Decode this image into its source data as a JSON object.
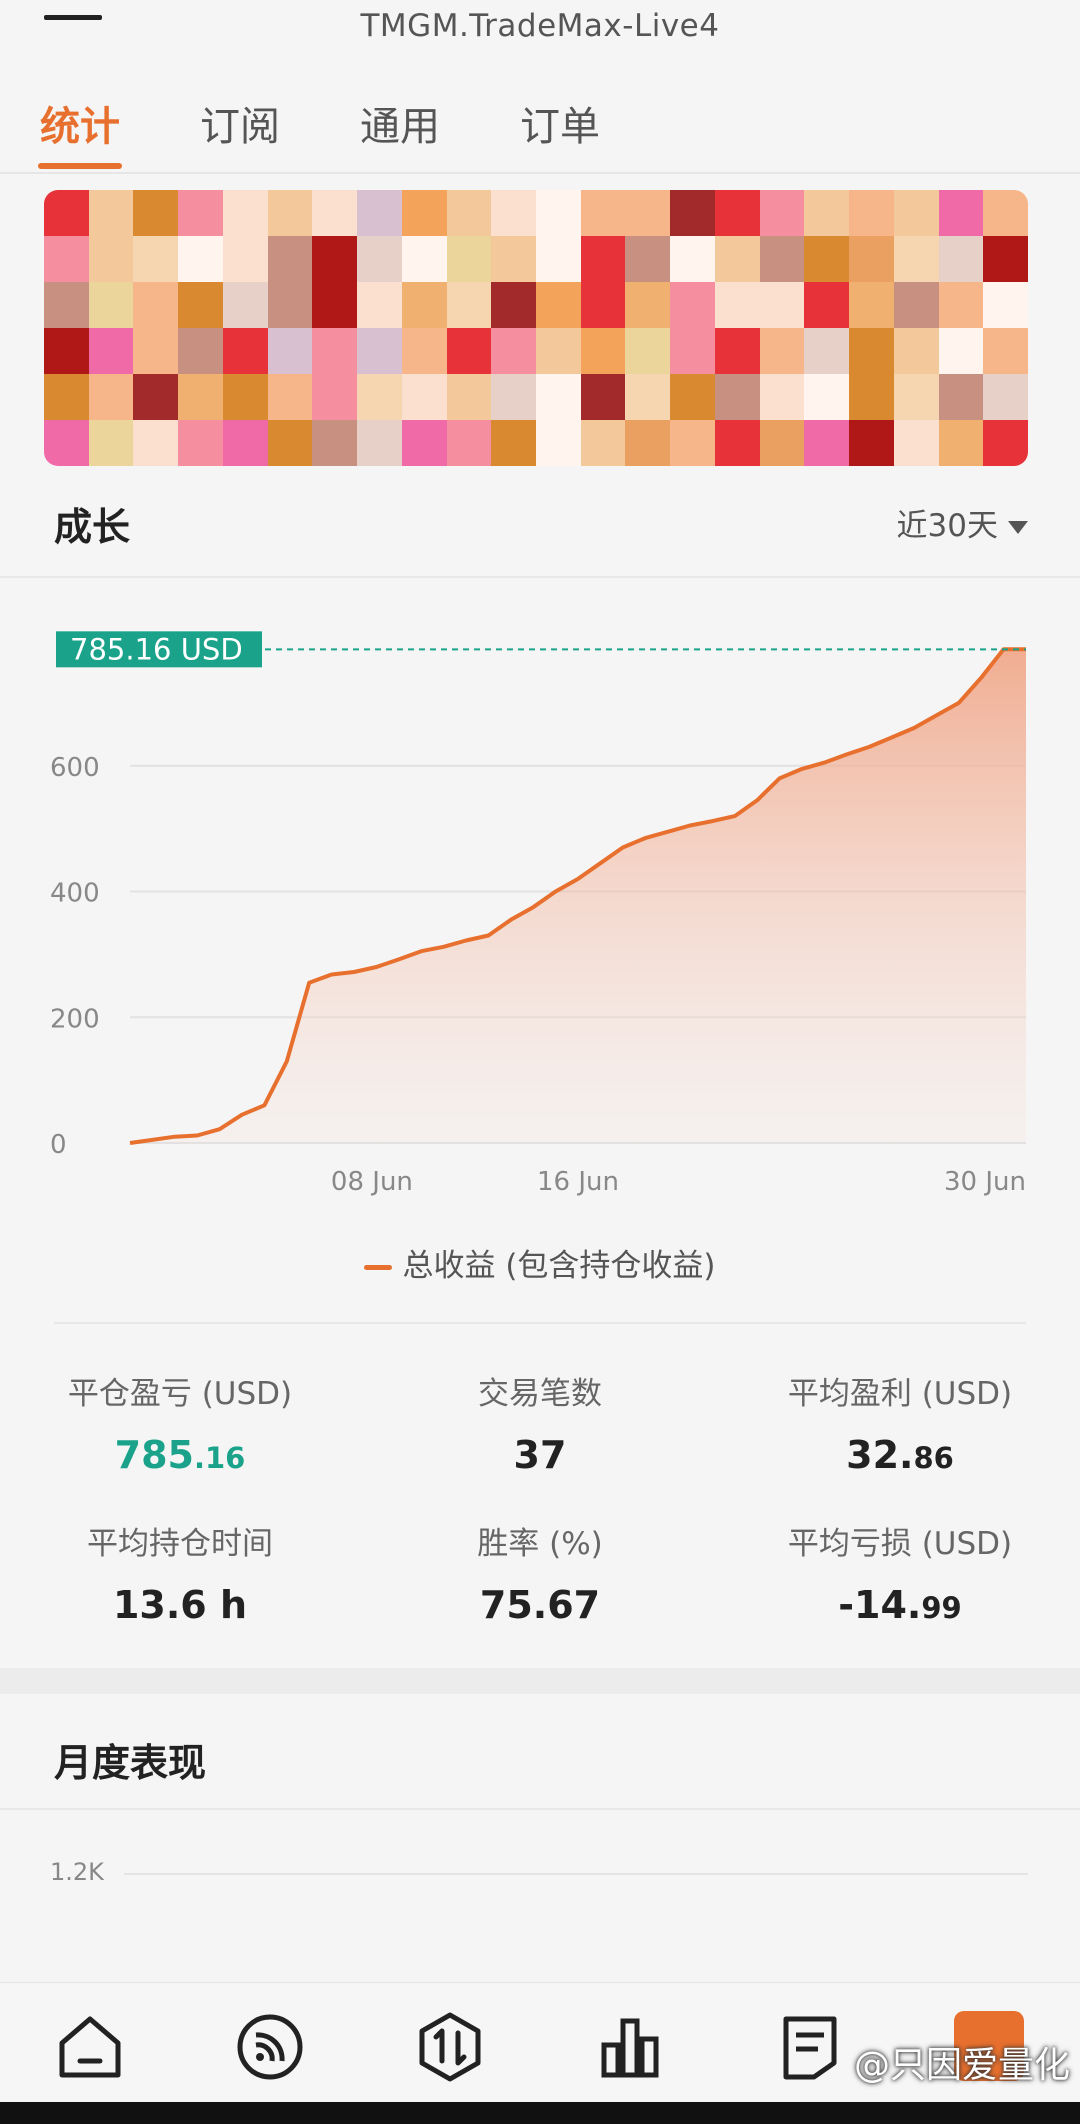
{
  "header": {
    "title": "TMGM.TradeMax-Live4",
    "menu_icon": "hamburger-icon"
  },
  "tabs": [
    {
      "label": "统计",
      "active": true
    },
    {
      "label": "订阅",
      "active": false
    },
    {
      "label": "通用",
      "active": false
    },
    {
      "label": "订单",
      "active": false
    }
  ],
  "growth": {
    "title": "成长",
    "period": "近30天"
  },
  "chart_data": {
    "type": "area",
    "series": [
      {
        "name": "总收益 (包含持仓收益)",
        "color": "#e8702e",
        "values": [
          0,
          5,
          10,
          12,
          22,
          45,
          60,
          130,
          255,
          268,
          272,
          280,
          292,
          305,
          312,
          322,
          330,
          355,
          375,
          400,
          420,
          445,
          470,
          485,
          495,
          505,
          512,
          520,
          545,
          580,
          595,
          605,
          618,
          630,
          645,
          660,
          680,
          700,
          740,
          785.16,
          785.16
        ]
      }
    ],
    "x_tick_labels": [
      "08 Jun",
      "16 Jun",
      "30 Jun"
    ],
    "y_tick_labels": [
      "0",
      "200",
      "400",
      "600"
    ],
    "ylim": [
      0,
      800
    ],
    "current_value_label": "785.16 USD",
    "grid": true,
    "legend_position": "bottom-center"
  },
  "stats": [
    {
      "label": "平仓盈亏 (USD)",
      "int": "785",
      "dec": ".16",
      "color": "green"
    },
    {
      "label": "交易笔数",
      "int": "37",
      "dec": ""
    },
    {
      "label": "平均盈利 (USD)",
      "int": "32.",
      "dec": "86"
    },
    {
      "label": "平均持仓时间",
      "int": "13.6 h",
      "dec": ""
    },
    {
      "label": "胜率 (%)",
      "int": "75.67",
      "dec": ""
    },
    {
      "label": "平均亏损 (USD)",
      "int": "-14.",
      "dec": "99"
    }
  ],
  "monthly": {
    "title": "月度表现",
    "y_tick": "1.2K"
  },
  "bottom_nav": {
    "items": [
      "home-icon",
      "feed-icon",
      "trade-icon",
      "chart-bars-icon",
      "orders-icon",
      "profile-icon"
    ]
  },
  "watermark": "@只因爱量化",
  "colors": {
    "accent": "#e8702e",
    "positive": "#1aa38a"
  }
}
